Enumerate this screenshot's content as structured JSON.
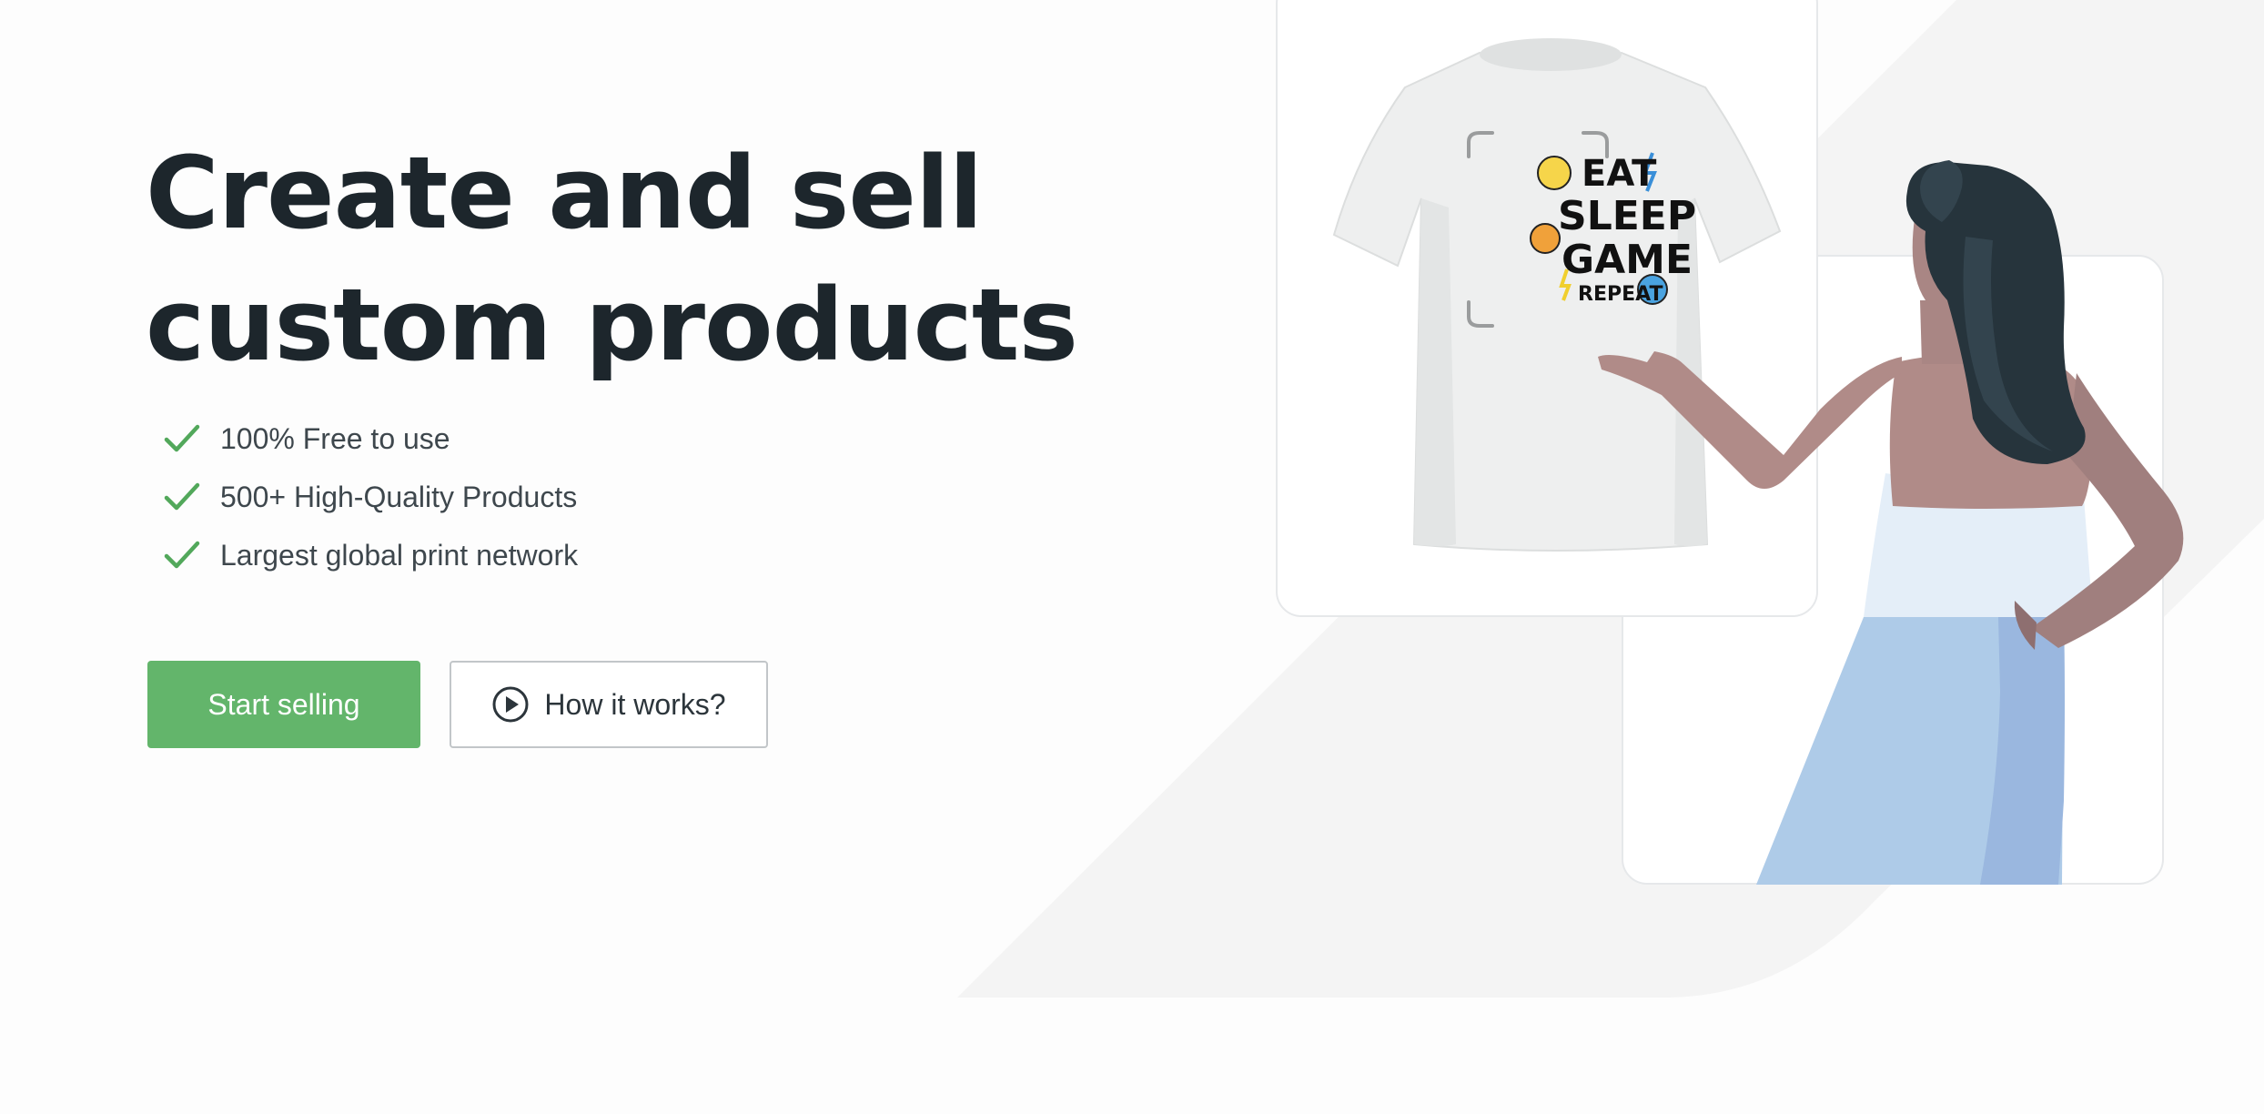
{
  "hero": {
    "title_line1": "Create and sell",
    "title_line2": "custom products"
  },
  "features": [
    {
      "text": "100% Free to use",
      "icon": "check-icon"
    },
    {
      "text": "500+ High-Quality Products",
      "icon": "check-icon"
    },
    {
      "text": "Largest global print network",
      "icon": "check-icon"
    }
  ],
  "cta": {
    "primary_label": "Start selling",
    "secondary_label": "How it works?",
    "secondary_icon": "play-circle-icon"
  },
  "mockup": {
    "print_lines": [
      "EAT",
      "SLEEP",
      "GAME",
      "REPEAT"
    ]
  },
  "colors": {
    "accent_green": "#63b56b",
    "heading": "#1d262c",
    "body_text": "#3e474d"
  }
}
